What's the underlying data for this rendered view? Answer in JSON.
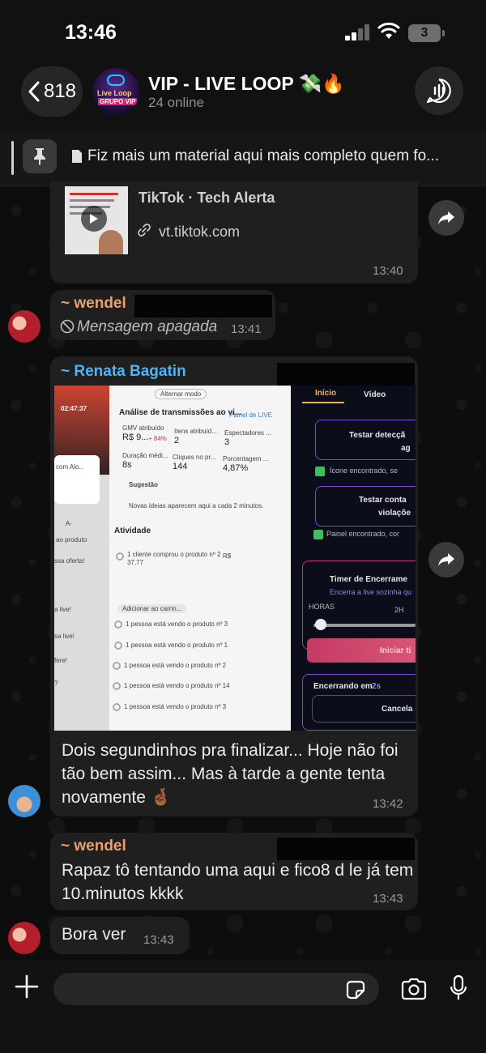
{
  "status_bar": {
    "time": "13:46",
    "battery": "3"
  },
  "header": {
    "back_count": "818",
    "group_name": "VIP - LIVE LOOP 💸🔥",
    "online": "24 online",
    "avatar_line1": "Live Loop",
    "avatar_line2": "GRUPO VIP"
  },
  "pinned": {
    "text": "Fiz mais um material aqui mais completo quem fo..."
  },
  "messages": {
    "link": {
      "title": "TikTok · Tech Alerta",
      "url": "vt.tiktok.com",
      "time": "13:40"
    },
    "deleted": {
      "sender": "~ wendel",
      "text": "Mensagem apagada",
      "time": "13:41"
    },
    "renata": {
      "sender": "~ Renata Bagatin",
      "text": "Dois segundinhos pra finalizar... Hoje não foi tão bem assim... Mas à tarde a gente tenta novamente 🤞🏾",
      "time": "13:42"
    },
    "wendel2": {
      "sender": "~ wendel",
      "text": "Rapaz tô tentando uma aqui e fico8 d le já tem 10.minutos kkkk",
      "time": "13:43"
    },
    "bora": {
      "text": "Bora ver",
      "time": "13:43"
    }
  },
  "screenshot": {
    "clock": "02:47:37",
    "alternar": "Alternar modo",
    "analise": "Análise de transmissões ao vi...",
    "painel_live": "Painel de LIVE",
    "gmv_label": "GMV atribuído",
    "gmv_value": "R$ 9...",
    "gmv_delta": "+ 84%",
    "itens_label": "Itens atribuíd...",
    "itens_value": "2",
    "espect_label": "Espectadores ...",
    "espect_value": "3",
    "duracao_label": "Duração médi...",
    "duracao_value": "8s",
    "cliques_label": "Cliques no pr...",
    "cliques_value": "144",
    "porc_label": "Porcentagem ...",
    "porc_value": "4,87%",
    "sugestao": "Sugestão",
    "novas_ideias": "Novas ideias aparecem aqui a cada 2 minutos.",
    "atividade": "Atividade",
    "cliente": "1 cliente comprou o produto nº 2",
    "rs": "R$",
    "rs_value": "37,77",
    "adicionar": "Adicionar ao carrin...",
    "vendo": [
      "1 pessoa está vendo o produto nº 3",
      "1 pessoa está vendo o produto nº 1",
      "1 pessoa está vendo o produto nº 2",
      "1 pessoa está vendo o produto nº 14",
      "1 pessoa está vendo o produto nº 3"
    ],
    "left_texts": [
      "com Alo...",
      "A-",
      "ao produto",
      "ssa oferta!",
      "a live!",
      "sa live!",
      "fere!",
      "?"
    ],
    "tab_inicio": "Início",
    "tab_video": "Vídeo",
    "testar_deteccao": "Testar detecçã",
    "testar_deteccao2": "ag",
    "icone_encontrado": "Ícone encontrado, se",
    "testar_contato": "Testar conta",
    "violacoes": "violaçõe",
    "painel_encontrado": "Painel encontrado, cor",
    "timer": "Timer de Encerrame",
    "encerra": "Encerra a live sozinha qu",
    "horas": "HORAS",
    "horas_val": "2H",
    "iniciar": "Iniciar ti",
    "encerrando": "Encerrando em",
    "encerrando_val": "2s",
    "cancelar": "Cancela"
  },
  "colors": {
    "wendel": "#e8a06e",
    "renata": "#4fb3f6",
    "bubble": "#1f1f1f"
  }
}
